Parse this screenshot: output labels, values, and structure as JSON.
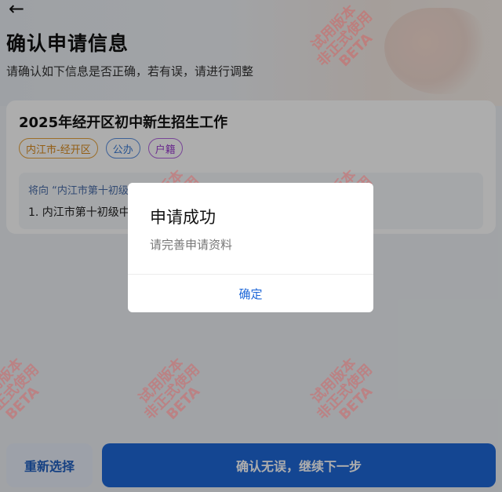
{
  "header": {
    "back_icon": "arrow-left-icon",
    "title": "确认申请信息",
    "subtitle": "请确认如下信息是否正确，若有误，请进行调整"
  },
  "card": {
    "title": "2025年经开区初中新生招生工作",
    "tags": [
      {
        "label": "内江市-经开区",
        "color": "#e6a23c"
      },
      {
        "label": "公办",
        "color": "#5b8fe0"
      },
      {
        "label": "户籍",
        "color": "#b266e0"
      }
    ],
    "intent_text": "将向 “内江市第十初级中学",
    "school_item": "1. 内江市第十初级中学"
  },
  "buttons": {
    "reselect": "重新选择",
    "confirm": "确认无误，继续下一步"
  },
  "dialog": {
    "title": "申请成功",
    "message": "请完善申请资料",
    "ok": "确定"
  },
  "watermark": {
    "line1": "试用版本",
    "line2": "非正式使用",
    "line3": "BETA"
  },
  "colors": {
    "primary": "#1e67d8",
    "tag_orange": "#e6a23c",
    "tag_blue": "#5b8fe0",
    "tag_purple": "#b266e0",
    "watermark": "#eb4646"
  }
}
